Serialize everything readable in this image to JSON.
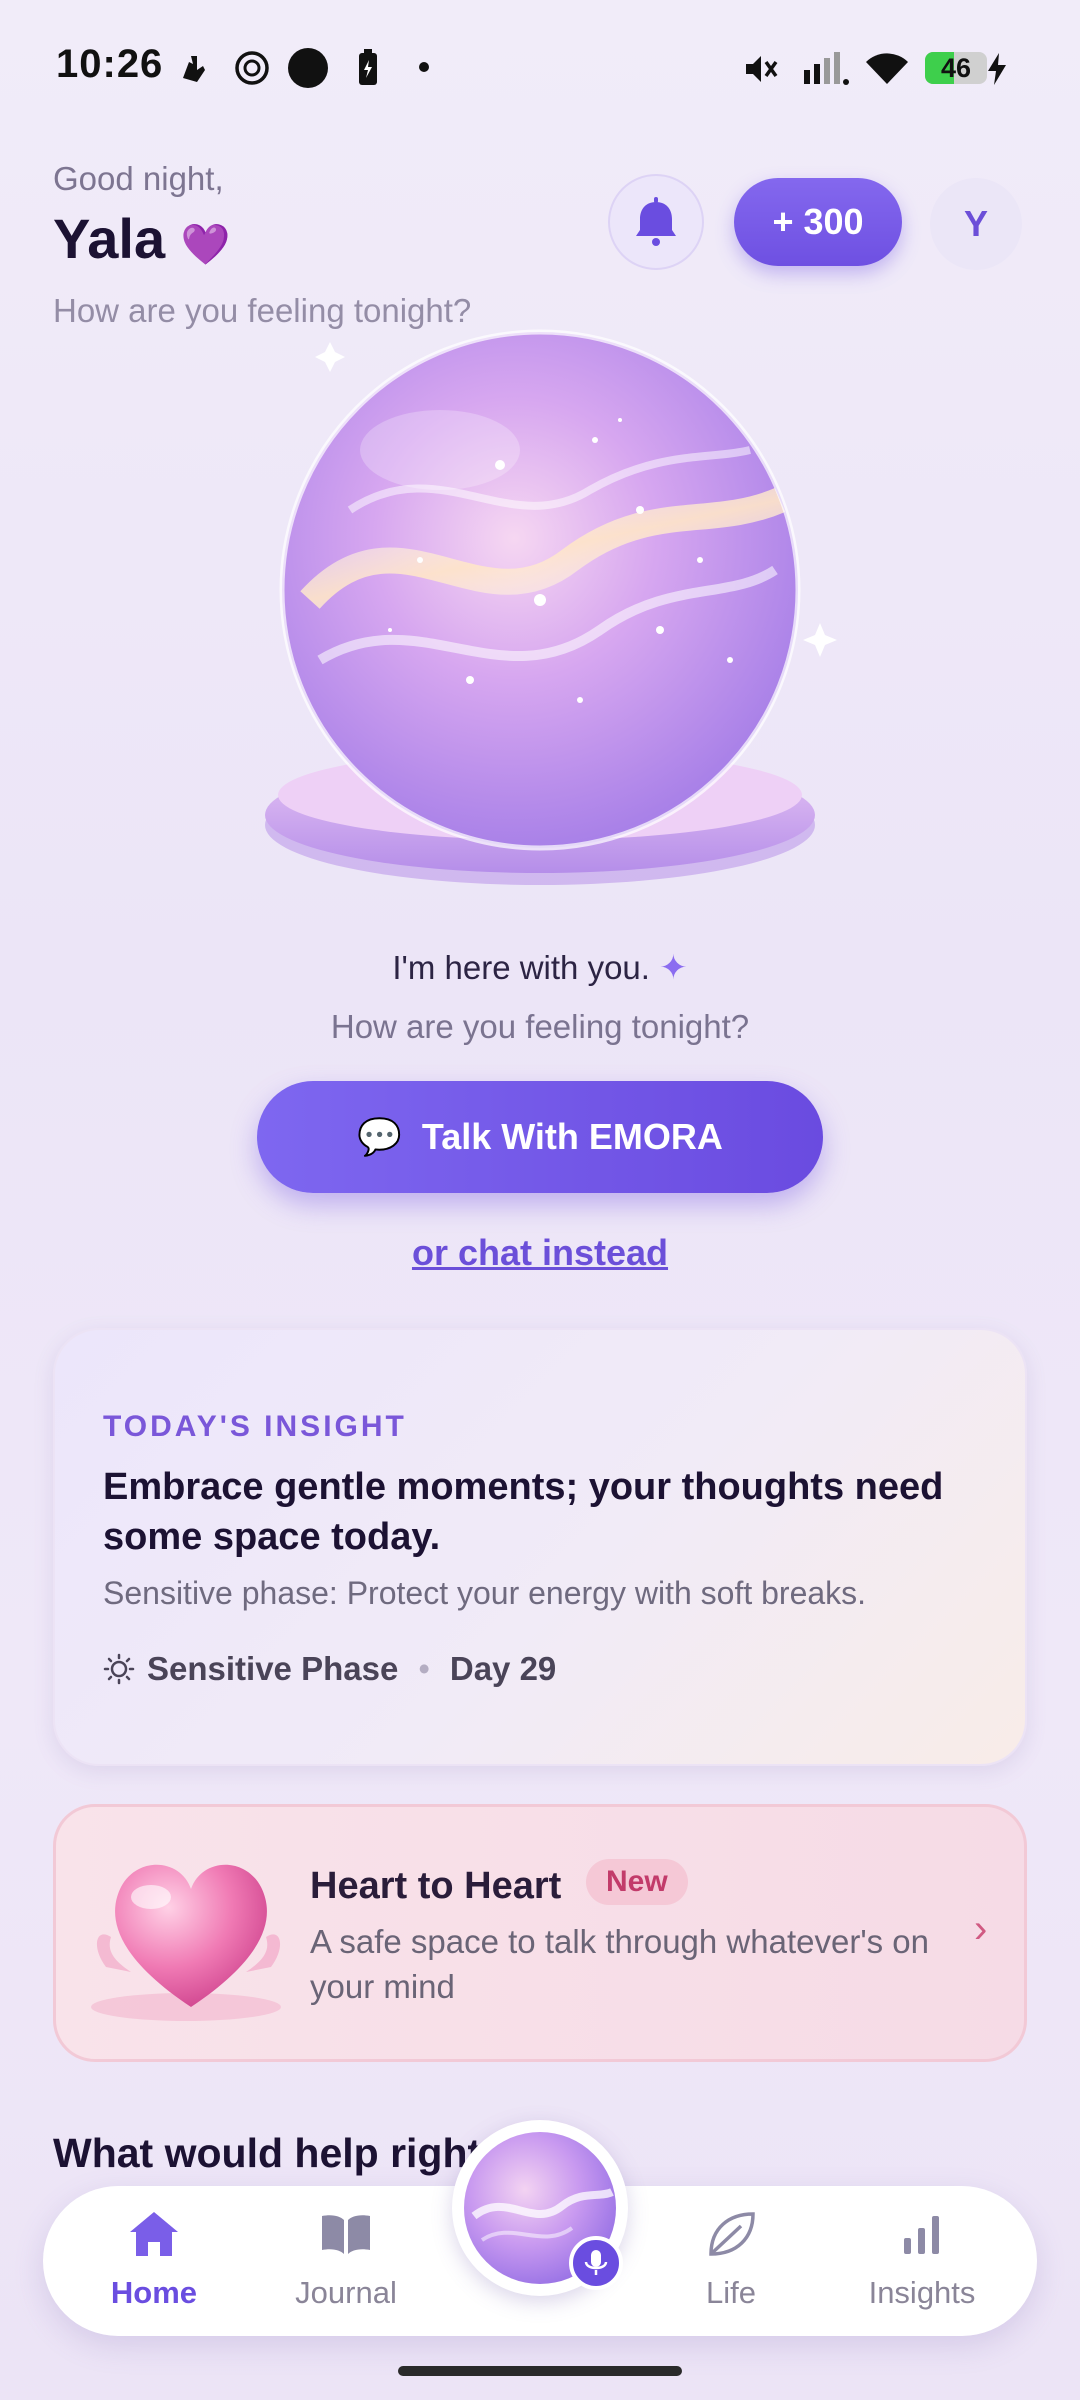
{
  "status_bar": {
    "time": "10:26",
    "battery_percent": "46",
    "battery_level": 0.46,
    "icons": [
      "hand-icon",
      "openai-icon",
      "circle-icon",
      "battery-saver-icon",
      "dot-icon",
      "mute-icon",
      "signal-icon",
      "wifi-icon",
      "charging-icon"
    ]
  },
  "header": {
    "greeting": "Good night,",
    "name": "Yala",
    "name_emoji": "💜",
    "subtitle": "How are you feeling tonight?",
    "points_label": "+ 300",
    "avatar_initial": "Y"
  },
  "hero": {
    "message": "I'm here with you.",
    "sparkle": "✦",
    "question": "How are you feeling tonight?",
    "talk_button": "Talk With EMORA",
    "talk_icon": "💬",
    "chat_link": "or chat instead"
  },
  "insight": {
    "kicker": "TODAY'S INSIGHT",
    "title": "Embrace gentle moments; your thoughts need some space today.",
    "subtitle": "Sensitive phase: Protect your energy with soft breaks.",
    "phase": "Sensitive Phase",
    "day": "Day 29"
  },
  "heart_card": {
    "title": "Heart to Heart",
    "badge": "New",
    "description": "A safe space to talk through whatever's on your mind",
    "chevron": "›"
  },
  "section": {
    "help_title": "What would help right"
  },
  "nav": {
    "items": [
      {
        "label": "Home",
        "icon": "home-icon",
        "active": true
      },
      {
        "label": "Journal",
        "icon": "book-icon",
        "active": false
      },
      {
        "label": "Life",
        "icon": "leaf-icon",
        "active": false
      },
      {
        "label": "Insights",
        "icon": "bar-chart-icon",
        "active": false
      }
    ]
  },
  "colors": {
    "accent": "#6a4de0",
    "accent_light": "#8468ee",
    "pink_badge": "#c23b6a",
    "background": "#efe8f8"
  }
}
